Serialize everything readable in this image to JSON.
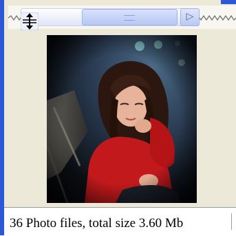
{
  "toolbar": {
    "slider_icon": "vertical-resize-icon",
    "scroll_arrow_icon": "arrow-right-icon",
    "scroll_arrow_glyph": "▷"
  },
  "preview": {
    "image_description": "photo-thumbnail"
  },
  "status": {
    "text": "36 Photo files, total size 3.60 Mb"
  },
  "colors": {
    "window_border": "#2a58d6",
    "panel_bg": "#ece9d8",
    "scroll_thumb": "#b6c7f4"
  }
}
